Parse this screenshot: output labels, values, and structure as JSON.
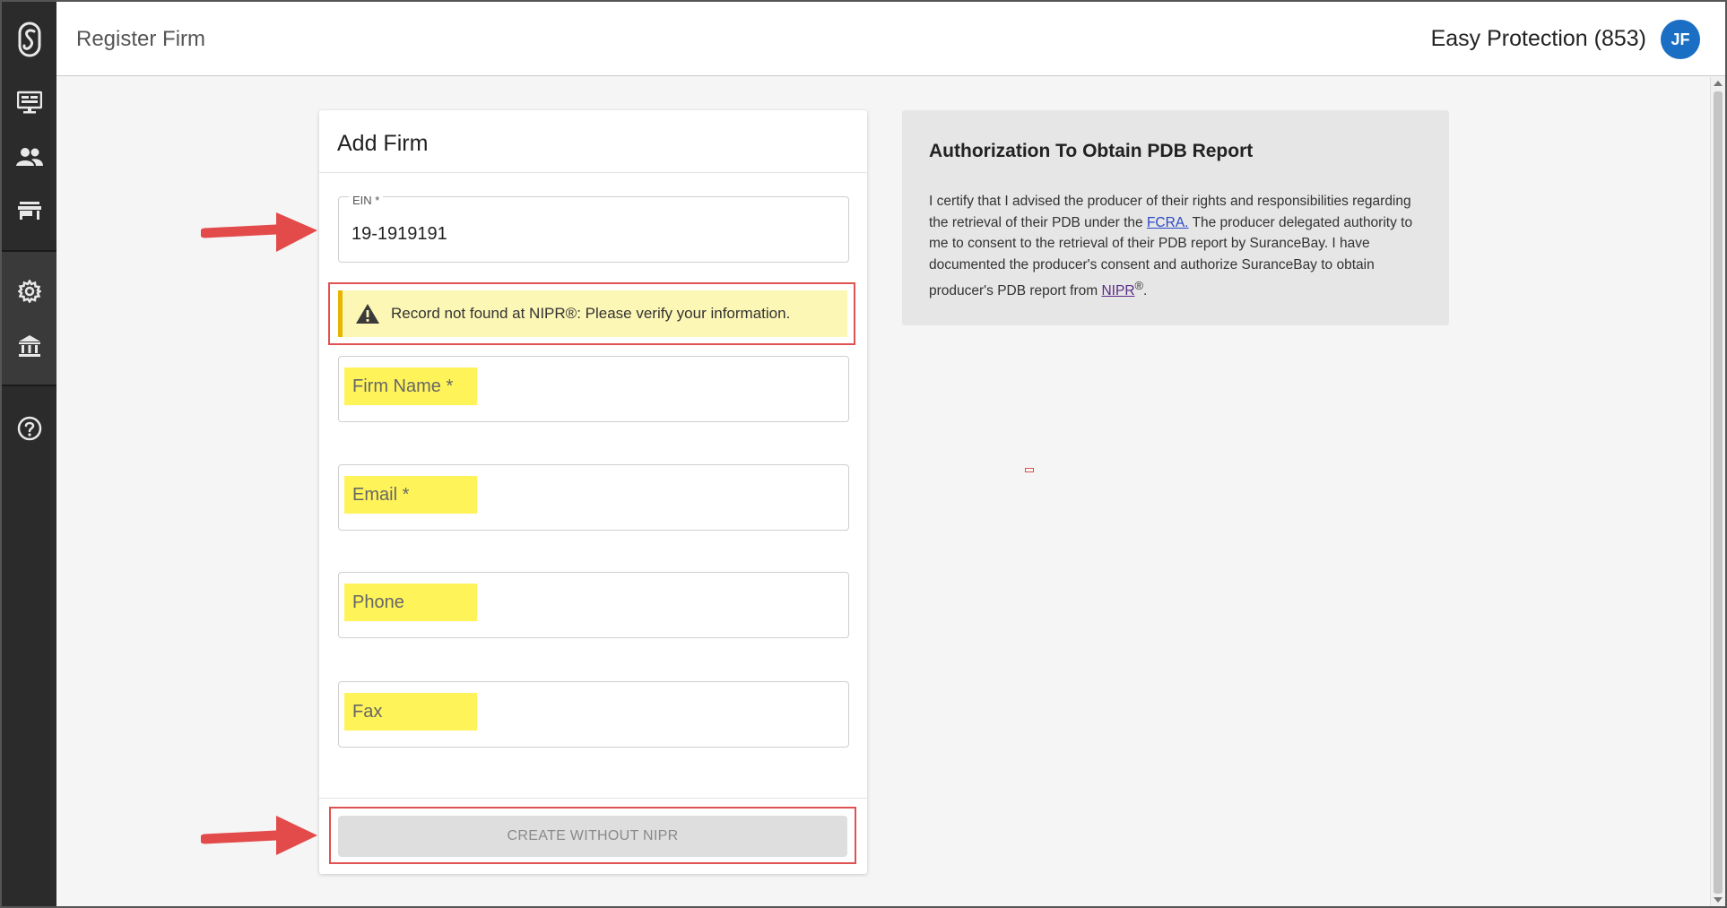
{
  "header": {
    "page_title": "Register Firm",
    "account": "Easy Protection (853)",
    "avatar_initials": "JF"
  },
  "sidebar": {
    "items": [
      {
        "name": "logo-icon"
      },
      {
        "name": "monitor-icon"
      },
      {
        "name": "users-icon"
      },
      {
        "name": "store-icon"
      },
      {
        "name": "gear-icon"
      },
      {
        "name": "bank-icon"
      },
      {
        "name": "help-icon"
      }
    ]
  },
  "form": {
    "title": "Add Firm",
    "ein": {
      "label": "EIN *",
      "value": "19-1919191"
    },
    "alert": "Record not found at NIPR®: Please verify your information.",
    "firm_name": {
      "placeholder": "Firm Name *",
      "value": ""
    },
    "email": {
      "placeholder": "Email *",
      "value": ""
    },
    "phone": {
      "placeholder": "Phone",
      "value": ""
    },
    "fax": {
      "placeholder": "Fax",
      "value": ""
    },
    "submit_label": "CREATE WITHOUT NIPR"
  },
  "authorization": {
    "title": "Authorization To Obtain PDB Report",
    "text_1": "I certify that I advised the producer of their rights and responsibilities regarding the retrieval of their PDB under the ",
    "fcra_link": "FCRA.",
    "text_2": " The producer delegated authority to me to consent to the retrieval of their PDB report by SuranceBay. I have documented the producer's consent and authorize SuranceBay to obtain producer's PDB report from ",
    "nipr_link": "NIPR",
    "nipr_sup": "®",
    "text_3": "."
  },
  "colors": {
    "sidebar": "#2b2b2b",
    "accent": "#1a6fc4",
    "highlight": "#fff35a",
    "annotation": "#e05252"
  }
}
